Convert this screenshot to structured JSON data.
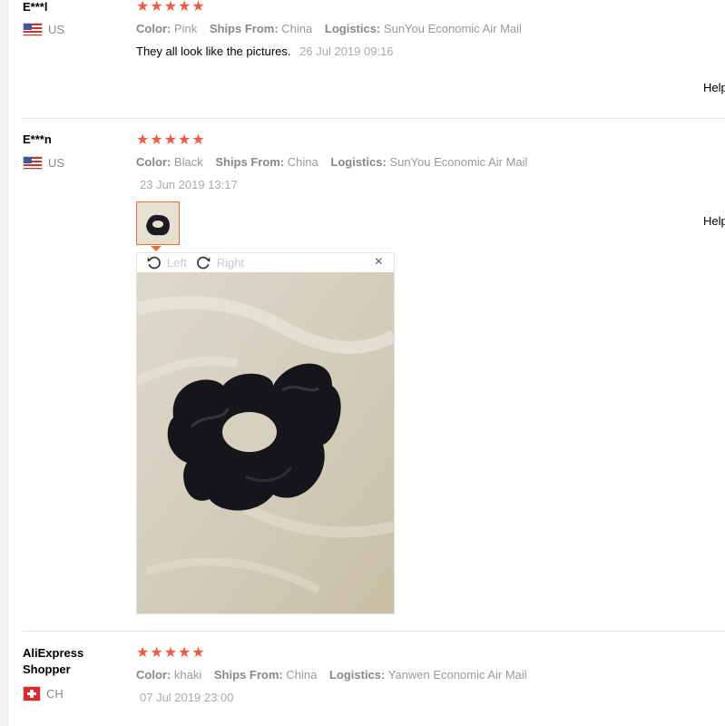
{
  "reviews": [
    {
      "user": "E***l",
      "country": "US",
      "stars": "★★★★★",
      "color_label": "Color:",
      "color_value": "Pink",
      "ships_label": "Ships From:",
      "ships_value": "China",
      "logistics_label": "Logistics:",
      "logistics_value": "SunYou Economic Air Mail",
      "text": "They all look like the pictures.",
      "date": "26 Jul 2019 09:16",
      "helpful": "Helpful?"
    },
    {
      "user": "E***n",
      "country": "US",
      "stars": "★★★★★",
      "color_label": "Color:",
      "color_value": "Black",
      "ships_label": "Ships From:",
      "ships_value": "China",
      "logistics_label": "Logistics:",
      "logistics_value": "SunYou Economic Air Mail",
      "date": "23 Jun 2019 13:17",
      "helpful": "Helpful?"
    },
    {
      "user": "AliExpress Shopper",
      "country": "CH",
      "stars": "★★★★★",
      "color_label": "Color:",
      "color_value": "khaki",
      "ships_label": "Ships From:",
      "ships_value": "China",
      "logistics_label": "Logistics:",
      "logistics_value": "Yanwen Economic Air Mail",
      "date": "07 Jul 2019 23:00"
    }
  ],
  "viewer": {
    "rotate_left": "Left",
    "rotate_right": "Right",
    "close": "×"
  }
}
